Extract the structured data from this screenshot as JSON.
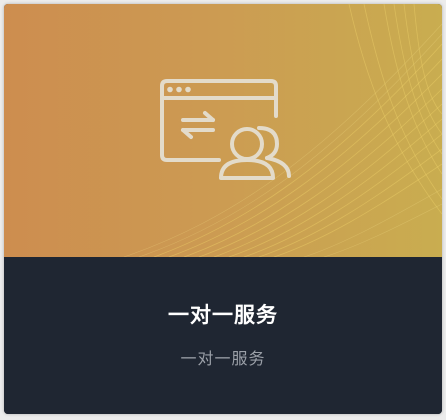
{
  "card": {
    "title": "一对一服务",
    "subtitle": "一对一服务",
    "icon": "browser-with-users-icon"
  },
  "colors": {
    "banner_left": "#cd8d4f",
    "banner_right": "#c9ad50",
    "info_background": "#1f2632",
    "title_text": "#ffffff",
    "subtitle_text": "#9ba0a8",
    "icon_stroke": "#e3dbca"
  }
}
